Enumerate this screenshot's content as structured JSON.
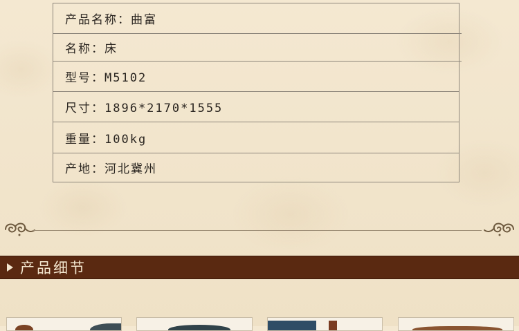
{
  "spec_table": {
    "rows": [
      "产品名称：曲富",
      "名称：床",
      "型号：M5102",
      "尺寸：1896*2170*1555",
      "重量：100kg",
      "产地：河北冀州"
    ]
  },
  "section": {
    "title": "产品细节"
  },
  "colors": {
    "bar_background": "#5a2911",
    "bar_text": "#f3e6cf",
    "page_background": "#f1e4cb",
    "table_border": "#8c857a"
  },
  "icons": {
    "section_marker": "triangle-right-icon",
    "divider_left": "flourish-icon",
    "divider_right": "flourish-icon"
  }
}
